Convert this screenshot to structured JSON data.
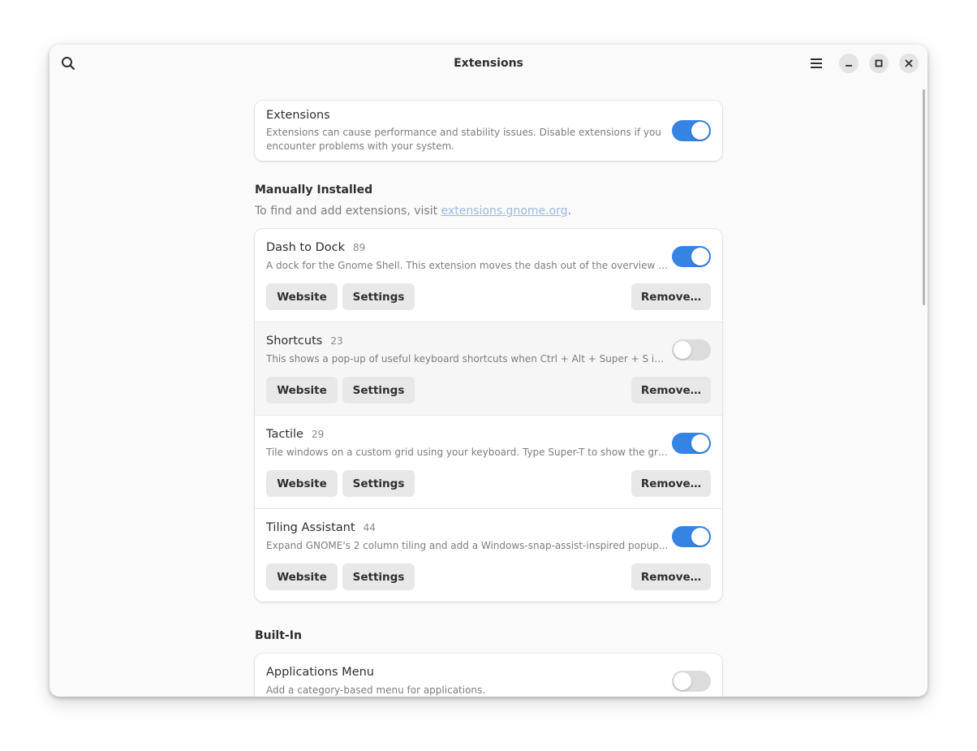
{
  "window": {
    "title": "Extensions"
  },
  "toggle_card": {
    "title": "Extensions",
    "description": "Extensions can cause performance and stability issues. Disable extensions if you encounter problems with your system.",
    "enabled": true
  },
  "manual": {
    "title": "Manually Installed",
    "desc_prefix": "To find and add extensions, visit ",
    "desc_link": "extensions.gnome.org",
    "desc_suffix": ".",
    "extensions": [
      {
        "name": "Dash to Dock",
        "version": "89",
        "description": "A dock for the Gnome Shell. This extension moves the dash out of the overview transforming it in a dock",
        "enabled": true,
        "website_label": "Website",
        "settings_label": "Settings",
        "remove_label": "Remove…"
      },
      {
        "name": "Shortcuts",
        "version": "23",
        "description": "This shows a pop-up of useful keyboard shortcuts when Ctrl + Alt + Super + S is pressed (hold to see)",
        "enabled": false,
        "website_label": "Website",
        "settings_label": "Settings",
        "remove_label": "Remove…"
      },
      {
        "name": "Tactile",
        "version": "29",
        "description": "Tile windows on a custom grid using your keyboard. Type Super-T to show the grid, then type two tiles",
        "enabled": true,
        "website_label": "Website",
        "settings_label": "Settings",
        "remove_label": "Remove…"
      },
      {
        "name": "Tiling Assistant",
        "version": "44",
        "description": "Expand GNOME's 2 column tiling and add a Windows-snap-assist-inspired popup...",
        "enabled": true,
        "website_label": "Website",
        "settings_label": "Settings",
        "remove_label": "Remove…"
      }
    ]
  },
  "builtin": {
    "title": "Built-In",
    "extensions": [
      {
        "name": "Applications Menu",
        "description": "Add a category-based menu for applications.",
        "enabled": false
      }
    ]
  },
  "icons": {
    "search": "search-icon",
    "menu": "hamburger-menu-icon",
    "minimize": "minimize-icon",
    "maximize": "maximize-icon",
    "close": "close-icon"
  },
  "colors": {
    "accent": "#3584e4",
    "toggle_off": "#dcdcdc",
    "link": "#99b8e0"
  }
}
